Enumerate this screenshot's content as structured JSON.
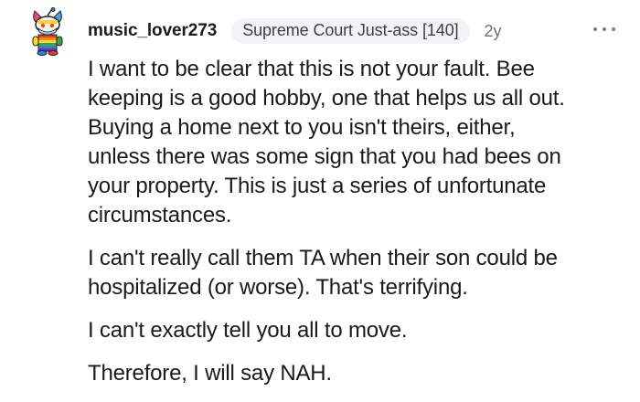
{
  "comment": {
    "username": "music_lover273",
    "flair": "Supreme Court Just-ass [140]",
    "age": "2y",
    "avatar_icon": "snoo-avatar-icon",
    "more_icon": "more-options-icon",
    "paragraphs": [
      "I want to be clear that this is not your fault. Bee\nkeeping is a good hobby, one that helps us all out.\nBuying a home next to you isn't theirs, either,\nunless there was some sign that you had bees on\nyour property. This is just a series of unfortunate\ncircumstances.",
      "I can't really call them TA when their son could be\nhospitalized (or worse). That's terrifying.",
      "I can't exactly tell you all to move.",
      "Therefore, I will say NAH."
    ]
  }
}
